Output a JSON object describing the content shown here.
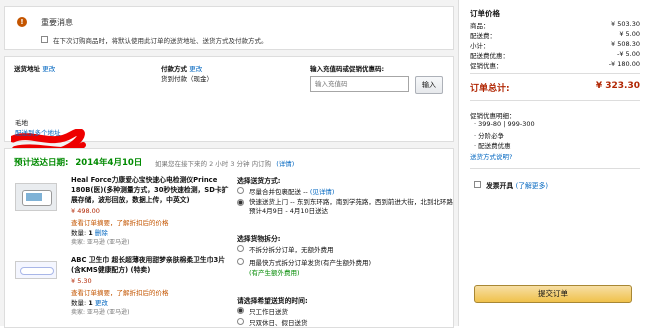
{
  "notice": {
    "title": "重要消息",
    "checkbox_label": "在下次订购商品时，将默认使用此订单的送货地址、送货方式及付款方式。"
  },
  "address": {
    "label": "送货地址",
    "change": "更改",
    "send_to_multi": "配送到多个地址",
    "partial": "毛地"
  },
  "payment": {
    "label": "付款方式",
    "change": "更改",
    "method": "货到付款（现金）"
  },
  "coupon": {
    "label": "输入充值码或促销优惠码:",
    "placeholder": "输入充值码",
    "button": "输入"
  },
  "delivery": {
    "estimate_label": "预计送达日期:",
    "date": "2014年4月10日",
    "countdown": "如果您在接下来的 2 小时 3 分钟 内订购",
    "details": "(详情)"
  },
  "products": [
    {
      "title": "Heal Force力康爱心宝快速心电检测仪Prince 180B(医)(多种测量方式，30秒快速检测，SD卡扩展存储，波形回放，数据上传，中英文)",
      "price": "¥ 498.00",
      "promo": "查看订单摘要，了解折扣后的价格",
      "qty_label": "数量:",
      "qty": "1",
      "qty_change": "删除",
      "seller": "卖家: 亚马逊 (亚马逊)"
    },
    {
      "title": "ABC 卫生巾 超长超薄夜用甜梦亲肤棉柔卫生巾3片(含KMS健康配方) (特卖)",
      "price": "¥ 5.30",
      "promo": "查看订单摘要，了解折扣后的价格",
      "qty_label": "数量:",
      "qty": "1",
      "qty_change": "更改",
      "seller": "卖家: 亚马逊 (亚马逊)"
    }
  ],
  "shipping": {
    "title": "选择送货方式:",
    "options": [
      {
        "label": "尽量合并包裹配送 -- ",
        "link": "(见详情)",
        "selected": false
      },
      {
        "label": "快速送货上门 -- 东到东环路，南到学苑路，西到前进大街，北到北环路 预计4月9日 - 4月10日送达",
        "selected": true
      }
    ]
  },
  "split": {
    "title": "选择货物拆分:",
    "options": [
      {
        "label": "不拆分拆分订单，无额外费用",
        "selected": false
      },
      {
        "label": "用最快方式拆分订单发货(有产生额外费用)",
        "selected": false,
        "note": "(有产生额外费用)"
      }
    ]
  },
  "time": {
    "title": "请选择希望送货的时间:",
    "options": [
      {
        "label": "只工作日送货",
        "selected": true
      },
      {
        "label": "只双休日、假日送货",
        "selected": false
      }
    ]
  },
  "summary": {
    "title": "订单价格",
    "rows": [
      {
        "label": "商品：",
        "value": "¥ 503.30"
      },
      {
        "label": "配送费：",
        "value": "¥ 5.00"
      },
      {
        "label": "小计：",
        "value": "¥ 508.30"
      },
      {
        "label": "配送费优惠：",
        "value": "-¥ 5.00"
      },
      {
        "label": "促销优惠：",
        "value": "-¥ 180.00"
      }
    ],
    "total_label": "订单总计:",
    "total_value": "¥ 323.30",
    "promo_title": "促销优惠明细：",
    "promo_items": [
      "399-80 | 999-300",
      "分阶必争",
      "配送费优惠"
    ],
    "promo_link": "送货方式说明?",
    "invoice_label": "发票开具",
    "invoice_link": "(了解更多)",
    "submit": "提交订单"
  }
}
